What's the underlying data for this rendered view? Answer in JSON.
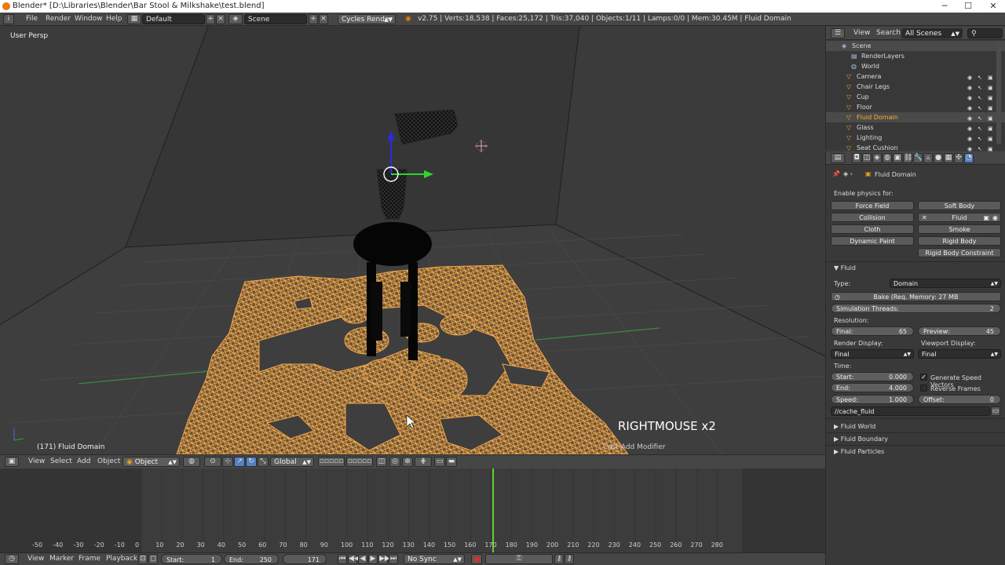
{
  "window": {
    "title": "Blender* [D:\\Libraries\\Blender\\Bar Stool & Milkshake\\test.blend]",
    "minimize": "─",
    "maximize": "☐",
    "close": "✕"
  },
  "infobar": {
    "menus": [
      "File",
      "Render",
      "Window",
      "Help"
    ],
    "screen_layout": "Default",
    "scene": "Scene",
    "render_engine": "Cycles Render",
    "stats": "v2.75 | Verts:18,538 | Faces:25,172 | Tris:37,040 | Objects:1/11 | Lamps:0/0 | Mem:30.45M | Fluid Domain"
  },
  "viewport": {
    "view_label": "User Persp",
    "object_label": "(171) Fluid Domain",
    "key_overlay": "RIGHTMOUSE x2",
    "operator_overlay": "Cast Add Modifier"
  },
  "view3d_header": {
    "menus": [
      "View",
      "Select",
      "Add",
      "Object"
    ],
    "mode": "Object Mode",
    "orientation": "Global"
  },
  "timeline": {
    "ticks": [
      "-50",
      "-40",
      "-30",
      "-20",
      "-10",
      "0",
      "10",
      "20",
      "30",
      "40",
      "50",
      "60",
      "70",
      "80",
      "90",
      "100",
      "110",
      "120",
      "130",
      "140",
      "150",
      "160",
      "170",
      "180",
      "190",
      "200",
      "210",
      "220",
      "230",
      "240",
      "250",
      "260",
      "270",
      "280"
    ],
    "current_frame": 171,
    "menus": [
      "View",
      "Marker",
      "Frame",
      "Playback"
    ],
    "start_label": "Start:",
    "start": "1",
    "end_label": "End:",
    "end": "250",
    "frame": "171",
    "sync": "No Sync"
  },
  "outliner": {
    "menus": [
      "View",
      "Search"
    ],
    "filter": "All Scenes",
    "rows": [
      {
        "name": "Scene"
      },
      {
        "name": "RenderLayers"
      },
      {
        "name": "World"
      },
      {
        "name": "Camera"
      },
      {
        "name": "Chair Legs"
      },
      {
        "name": "Cup"
      },
      {
        "name": "Floor"
      },
      {
        "name": "Fluid Domain"
      },
      {
        "name": "Glass"
      },
      {
        "name": "Lighting"
      },
      {
        "name": "Seat Cushion"
      }
    ]
  },
  "properties": {
    "context": "Fluid Domain",
    "enable_physics_label": "Enable physics for:",
    "physics_buttons": {
      "force_field": "Force Field",
      "soft_body": "Soft Body",
      "collision": "Collision",
      "fluid": "Fluid",
      "cloth": "Cloth",
      "smoke": "Smoke",
      "dynamic_paint": "Dynamic Paint",
      "rigid_body": "Rigid Body",
      "rigid_body_constraint": "Rigid Body Constraint"
    },
    "fluid_panel": {
      "title": "Fluid",
      "type_label": "Type:",
      "type": "Domain",
      "bake": "Bake (Req. Memory: 27 MB",
      "threads_label": "Simulation Threads:",
      "threads": "2",
      "resolution_label": "Resolution:",
      "final_label": "Final:",
      "final": "65",
      "preview_label": "Preview:",
      "preview": "45",
      "render_display_label": "Render Display:",
      "render_display": "Final",
      "viewport_display_label": "Viewport Display:",
      "viewport_display": "Final",
      "time_label": "Time:",
      "start_label": "Start:",
      "start": "0.000",
      "end_label": "End:",
      "end": "4.000",
      "speed_label": "Speed:",
      "speed": "1.000",
      "offset_label": "Offset:",
      "offset": "0",
      "gen_speed_vectors": "Generate Speed Vectors",
      "reverse_frames": "Reverse Frames",
      "cache_path": "//cache_fluid"
    },
    "collapsed_panels": [
      "Fluid World",
      "Fluid Boundary",
      "Fluid Particles"
    ]
  },
  "colors": {
    "wire_orange": "#f0a64c",
    "timeline_cursor": "#5fd42a",
    "x_axis_green": "#3f8f3f"
  }
}
